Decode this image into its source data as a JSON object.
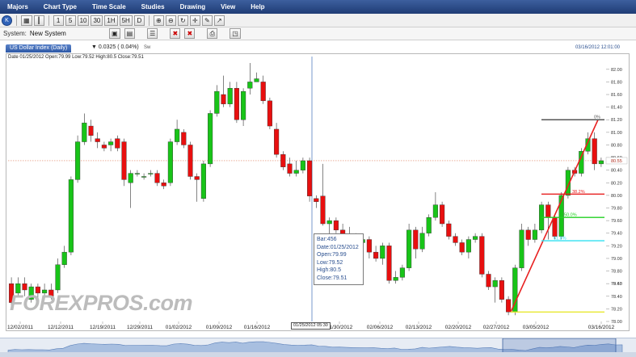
{
  "menu": [
    "Majors",
    "Chart Type",
    "Time Scale",
    "Studies",
    "Drawing",
    "View",
    "Help"
  ],
  "toolbar": {
    "home_icon": "K",
    "timeframes": [
      "1",
      "5",
      "10",
      "30",
      "1H",
      "5H",
      "D"
    ],
    "tools": [
      "zoom-in-icon",
      "zoom-out-icon",
      "refresh-icon",
      "crosshair-icon",
      "pen-icon",
      "arrow-icon"
    ]
  },
  "system": {
    "label": "System:",
    "value": "New System"
  },
  "instrument": {
    "name": "US Dollar Index (Daily)",
    "change": "0.0325 ( 0.04%)",
    "tab": "Sw",
    "datetime": "03/16/2012 12:01:00"
  },
  "ohlc_info": "Date 01/25/2012 Open:79.99 Low:79.52 High:80.5 Close:79.51",
  "tooltip": {
    "bar": "Bar:456",
    "date": "Date:01/25/2012",
    "open": "Open:79.99",
    "low": "Low:79.52",
    "high": "High:80.5",
    "close": "Close:79.51"
  },
  "watermark": "FOREXPROS.com",
  "crosshair_date_label": "01/25/2012 05:30",
  "fib_labels": [
    "38.2%",
    "50.0%",
    "61.8%",
    "0%"
  ],
  "price_marker": "80.55",
  "last_label": "79.43",
  "colors": {
    "up": "#18c418",
    "down": "#e80f0f",
    "fib_red": "#e82020",
    "fib_green": "#20d020",
    "fib_cyan": "#30e0f0",
    "fib_yellow": "#e8e830",
    "crosshair": "#5580c0"
  },
  "chart_data": {
    "type": "candlestick",
    "title": "US Dollar Index (Daily)",
    "x_ticks": [
      "12/02/2011",
      "12/12/2011",
      "12/19/2011",
      "12/29/2011",
      "01/02/2012",
      "01/09/2012",
      "01/16/2012",
      "01/30/2012",
      "02/06/2012",
      "02/13/2012",
      "02/20/2012",
      "02/27/2012",
      "03/05/2012",
      "03/16/2012"
    ],
    "y_ticks": [
      "82.00",
      "81.80",
      "81.60",
      "81.40",
      "81.20",
      "81.00",
      "80.80",
      "80.60",
      "80.40",
      "80.20",
      "80.00",
      "79.80",
      "79.60",
      "79.40",
      "79.20",
      "79.00",
      "78.80",
      "78.60",
      "78.40",
      "78.20",
      "78.00"
    ],
    "ylim": [
      78.0,
      82.1
    ],
    "candles": [
      [
        78.6,
        78.3,
        78.7,
        78.25
      ],
      [
        78.45,
        78.6,
        78.7,
        78.4
      ],
      [
        78.6,
        78.5,
        78.7,
        78.4
      ],
      [
        78.35,
        78.55,
        78.6,
        78.3
      ],
      [
        78.55,
        78.45,
        78.6,
        78.35
      ],
      [
        78.45,
        78.5,
        78.6,
        78.4
      ],
      [
        78.5,
        78.4,
        78.6,
        78.35
      ],
      [
        78.5,
        78.9,
        79.0,
        78.45
      ],
      [
        78.9,
        79.1,
        79.2,
        78.85
      ],
      [
        79.1,
        80.25,
        80.3,
        79.05
      ],
      [
        80.25,
        80.85,
        80.95,
        80.2
      ],
      [
        80.85,
        81.15,
        81.3,
        80.8
      ],
      [
        81.1,
        80.95,
        81.2,
        80.85
      ],
      [
        80.9,
        80.85,
        81.0,
        80.75
      ],
      [
        80.8,
        80.75,
        80.85,
        80.7
      ],
      [
        80.8,
        80.85,
        80.9,
        80.7
      ],
      [
        80.9,
        80.75,
        80.95,
        80.7
      ],
      [
        80.85,
        80.25,
        80.9,
        80.15
      ],
      [
        80.2,
        80.35,
        80.4,
        79.8
      ],
      [
        80.35,
        80.35,
        80.4,
        80.3
      ],
      [
        80.3,
        80.3,
        80.35,
        80.25
      ],
      [
        80.35,
        80.35,
        80.4,
        80.3
      ],
      [
        80.35,
        80.2,
        80.4,
        80.15
      ],
      [
        80.2,
        80.15,
        80.25,
        80.1
      ],
      [
        80.2,
        80.85,
        80.9,
        80.15
      ],
      [
        80.85,
        81.05,
        81.2,
        80.8
      ],
      [
        81.0,
        80.8,
        81.05,
        80.75
      ],
      [
        80.8,
        80.3,
        80.85,
        80.25
      ],
      [
        80.3,
        80.25,
        80.35,
        79.9
      ],
      [
        79.95,
        80.5,
        80.55,
        79.9
      ],
      [
        80.5,
        81.3,
        81.35,
        80.45
      ],
      [
        81.3,
        81.65,
        81.75,
        81.25
      ],
      [
        81.6,
        81.45,
        81.9,
        81.4
      ],
      [
        81.45,
        81.7,
        81.8,
        81.4
      ],
      [
        81.7,
        81.2,
        81.8,
        81.15
      ],
      [
        81.2,
        81.65,
        81.7,
        81.1
      ],
      [
        81.7,
        81.8,
        82.1,
        81.6
      ],
      [
        81.8,
        81.85,
        81.95,
        81.8
      ],
      [
        81.8,
        81.5,
        81.9,
        81.45
      ],
      [
        81.5,
        81.1,
        81.55,
        81.05
      ],
      [
        81.05,
        80.65,
        81.15,
        80.6
      ],
      [
        80.65,
        80.45,
        80.7,
        80.4
      ],
      [
        80.5,
        80.35,
        80.6,
        80.3
      ],
      [
        80.35,
        80.4,
        80.55,
        80.3
      ],
      [
        80.4,
        80.55,
        80.6,
        80.35
      ],
      [
        80.55,
        79.99,
        80.6,
        79.9
      ],
      [
        79.95,
        79.9,
        80.0,
        79.8
      ],
      [
        79.99,
        79.55,
        80.5,
        79.52
      ],
      [
        79.55,
        79.6,
        79.65,
        79.35
      ],
      [
        79.6,
        79.45,
        79.65,
        79.4
      ],
      [
        79.45,
        79.35,
        79.55,
        79.3
      ],
      [
        79.35,
        79.3,
        79.5,
        79.25
      ],
      [
        79.3,
        79.25,
        79.4,
        79.2
      ],
      [
        79.25,
        79.3,
        79.35,
        79.2
      ],
      [
        79.3,
        79.1,
        79.35,
        79.0
      ],
      [
        79.1,
        79.0,
        79.2,
        78.95
      ],
      [
        79.0,
        79.2,
        79.25,
        78.9
      ],
      [
        79.2,
        78.65,
        79.25,
        78.6
      ],
      [
        78.65,
        78.7,
        78.8,
        78.6
      ],
      [
        78.7,
        78.85,
        78.9,
        78.65
      ],
      [
        78.85,
        79.45,
        79.55,
        78.8
      ],
      [
        79.45,
        79.15,
        79.5,
        79.0
      ],
      [
        79.15,
        79.4,
        79.5,
        79.1
      ],
      [
        79.4,
        79.65,
        79.7,
        79.35
      ],
      [
        79.65,
        79.85,
        80.05,
        79.6
      ],
      [
        79.85,
        79.55,
        79.9,
        79.5
      ],
      [
        79.55,
        79.35,
        79.6,
        79.3
      ],
      [
        79.35,
        79.25,
        79.4,
        79.2
      ],
      [
        79.25,
        79.1,
        79.3,
        79.05
      ],
      [
        79.1,
        79.3,
        79.35,
        79.0
      ],
      [
        79.3,
        79.35,
        79.4,
        79.25
      ],
      [
        79.35,
        78.75,
        79.4,
        78.7
      ],
      [
        78.75,
        78.55,
        78.8,
        78.5
      ],
      [
        78.55,
        78.65,
        78.7,
        78.3
      ],
      [
        78.65,
        78.35,
        78.7,
        78.3
      ],
      [
        78.35,
        78.15,
        78.4,
        78.1
      ],
      [
        78.15,
        78.85,
        78.9,
        78.1
      ],
      [
        78.85,
        79.45,
        79.55,
        78.8
      ],
      [
        79.45,
        79.3,
        79.5,
        79.2
      ],
      [
        79.3,
        79.45,
        79.55,
        79.25
      ],
      [
        79.45,
        79.85,
        79.9,
        79.4
      ],
      [
        79.85,
        79.65,
        79.9,
        79.3
      ],
      [
        79.65,
        79.35,
        79.7,
        79.3
      ],
      [
        79.35,
        80.0,
        80.05,
        79.3
      ],
      [
        80.0,
        80.4,
        80.45,
        79.95
      ],
      [
        80.4,
        80.35,
        80.45,
        80.3
      ],
      [
        80.35,
        80.7,
        80.75,
        80.3
      ],
      [
        80.7,
        80.9,
        81.0,
        80.65
      ],
      [
        80.9,
        80.5,
        81.0,
        80.4
      ],
      [
        80.5,
        80.55,
        80.6,
        80.45
      ]
    ]
  }
}
